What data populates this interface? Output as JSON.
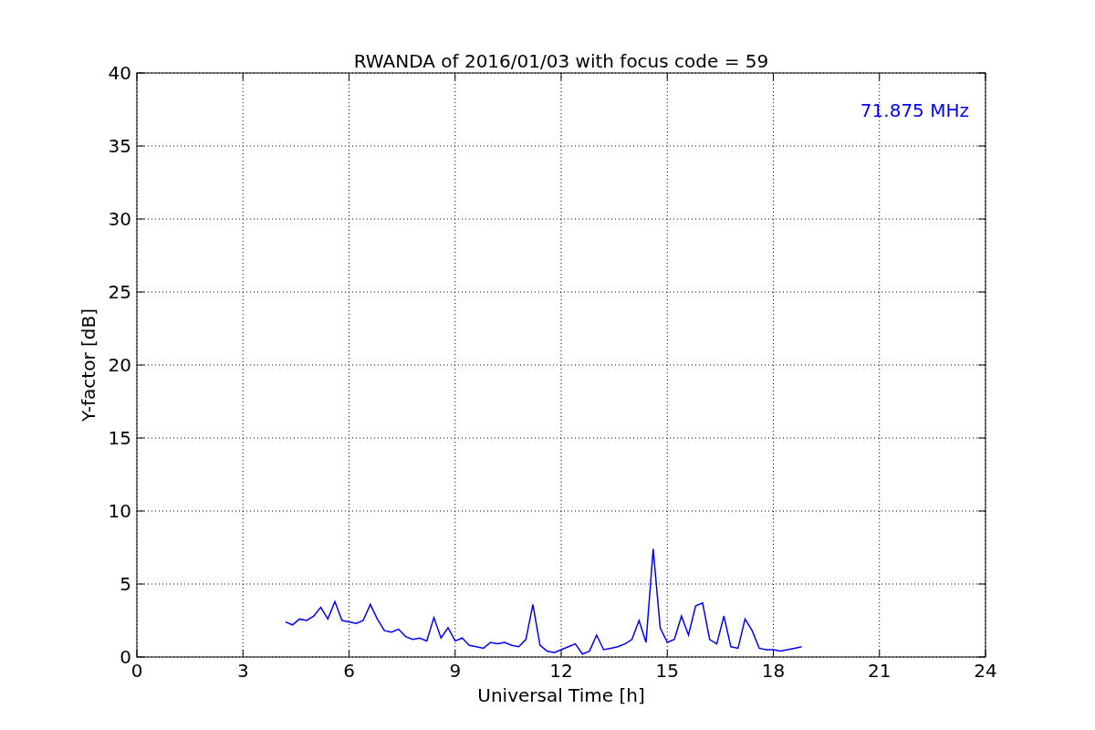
{
  "chart_data": {
    "type": "line",
    "title": "RWANDA of 2016/01/03 with focus code = 59",
    "xlabel": "Universal Time [h]",
    "ylabel": "Y-factor [dB]",
    "x": [
      4.2,
      4.4,
      4.6,
      4.8,
      5.0,
      5.2,
      5.4,
      5.6,
      5.8,
      6.0,
      6.2,
      6.4,
      6.6,
      6.8,
      7.0,
      7.2,
      7.4,
      7.6,
      7.8,
      8.0,
      8.2,
      8.4,
      8.6,
      8.8,
      9.0,
      9.2,
      9.4,
      9.6,
      9.8,
      10.0,
      10.2,
      10.4,
      10.6,
      10.8,
      11.0,
      11.2,
      11.4,
      11.6,
      11.8,
      12.0,
      12.2,
      12.4,
      12.6,
      12.8,
      13.0,
      13.2,
      13.4,
      13.6,
      13.8,
      14.0,
      14.2,
      14.4,
      14.6,
      14.8,
      15.0,
      15.2,
      15.4,
      15.6,
      15.8,
      16.0,
      16.2,
      16.4,
      16.6,
      16.8,
      17.0,
      17.2,
      17.4,
      17.6,
      17.8,
      18.0,
      18.2,
      18.4,
      18.6,
      18.8
    ],
    "series": [
      {
        "color": "#0000ff",
        "values": [
          2.4,
          2.2,
          2.6,
          2.5,
          2.8,
          3.4,
          2.6,
          3.8,
          2.5,
          2.4,
          2.3,
          2.5,
          3.6,
          2.6,
          1.8,
          1.7,
          1.9,
          1.4,
          1.2,
          1.3,
          1.1,
          2.7,
          1.3,
          2.0,
          1.1,
          1.3,
          0.8,
          0.7,
          0.6,
          1.0,
          0.9,
          1.0,
          0.8,
          0.7,
          1.2,
          3.6,
          0.8,
          0.4,
          0.3,
          0.5,
          0.7,
          0.9,
          0.2,
          0.4,
          1.5,
          0.5,
          0.6,
          0.7,
          0.9,
          1.2,
          2.5,
          1.0,
          7.4,
          2.0,
          1.0,
          1.2,
          2.8,
          1.5,
          3.5,
          3.7,
          1.2,
          0.9,
          2.8,
          0.7,
          0.6,
          2.6,
          1.8,
          0.6,
          0.5,
          0.5,
          0.4,
          0.5,
          0.6,
          0.7
        ]
      }
    ],
    "xlim": [
      0,
      24
    ],
    "ylim": [
      0,
      40
    ],
    "xticks": [
      0,
      3,
      6,
      9,
      12,
      15,
      18,
      21,
      24
    ],
    "yticks": [
      0,
      5,
      10,
      15,
      20,
      25,
      30,
      35,
      40
    ],
    "grid": true,
    "annotations": [
      "71.875 MHz"
    ]
  }
}
